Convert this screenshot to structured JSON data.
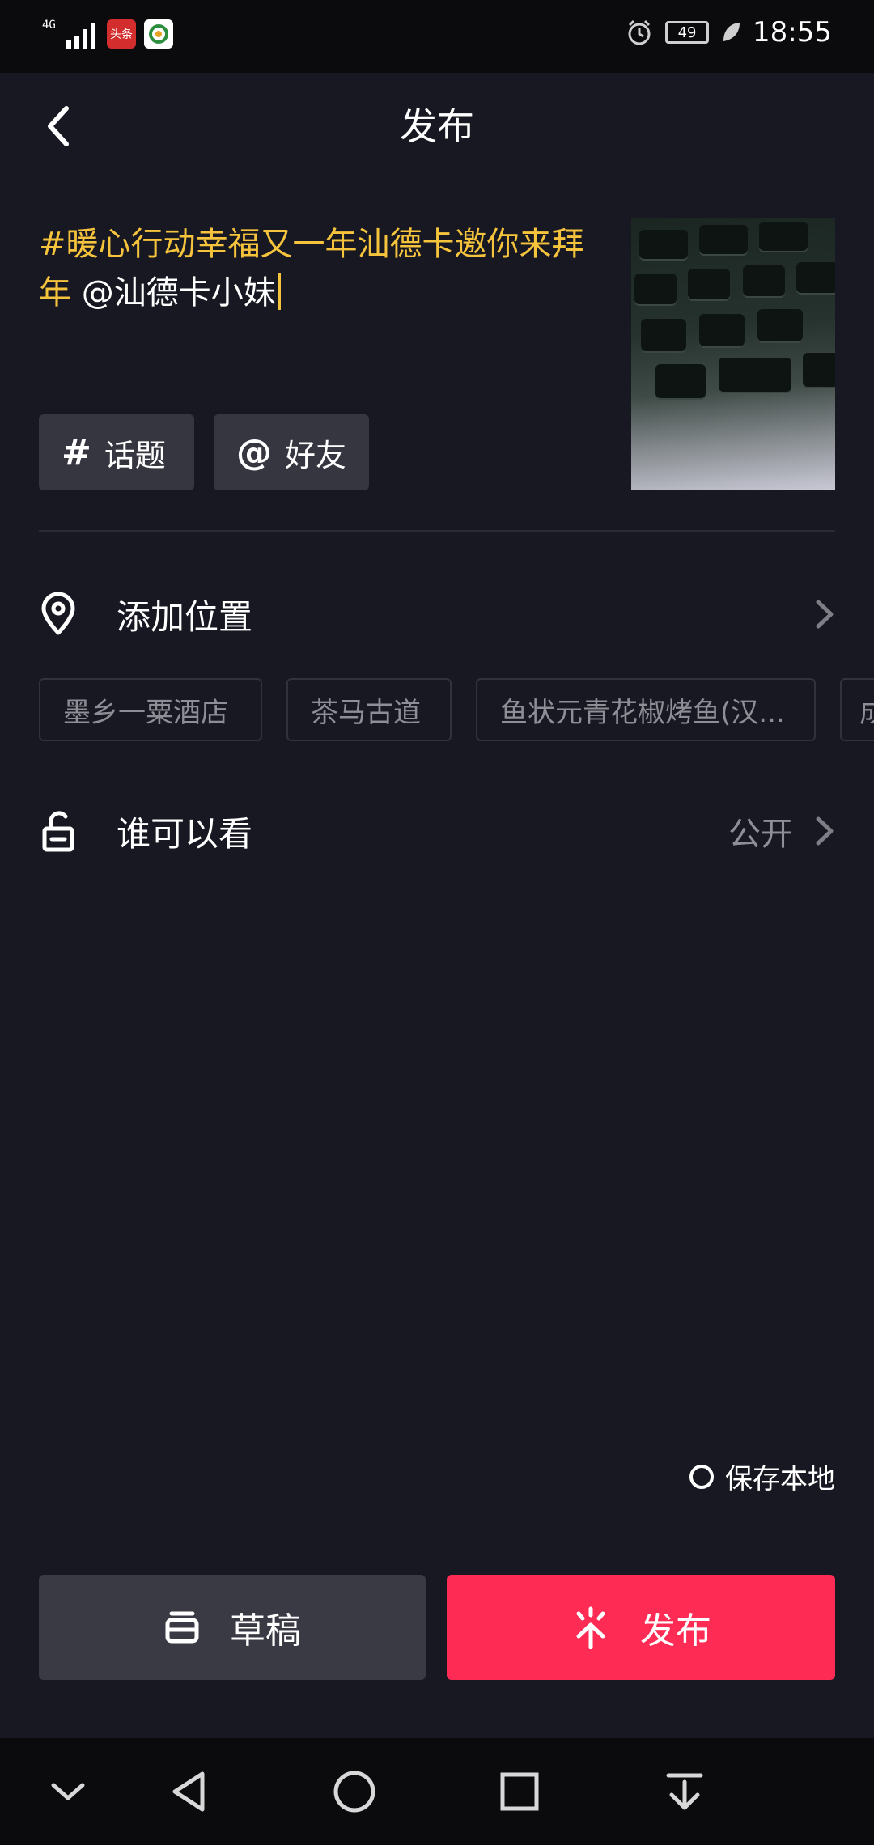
{
  "status_bar": {
    "network_type": "4G",
    "app_icon_1_label": "头条",
    "battery_level": "49",
    "time": "18:55"
  },
  "header": {
    "title": "发布"
  },
  "caption": {
    "hashtag": "#暖心行动幸福又一年汕德卡邀你来拜年",
    "mention": "@汕德卡小妹"
  },
  "chips": {
    "topic_label": "话题",
    "friend_label": "好友"
  },
  "location": {
    "label": "添加位置",
    "suggestions": [
      "墨乡一粟酒店",
      "茶马古道",
      "鱼状元青花椒烤鱼(汉...",
      "成"
    ]
  },
  "visibility": {
    "label": "谁可以看",
    "value": "公开"
  },
  "save_local": {
    "label": "保存本地"
  },
  "actions": {
    "draft_label": "草稿",
    "publish_label": "发布"
  },
  "colors": {
    "background": "#171822",
    "hashtag": "#f6c33c",
    "publish_button": "#fe2c55",
    "draft_button": "#3a3a45"
  },
  "icons": {
    "back": "chevron-left-icon",
    "location": "location-pin-icon",
    "visibility": "unlock-icon",
    "draft": "draft-box-icon",
    "publish": "upload-spark-icon"
  }
}
